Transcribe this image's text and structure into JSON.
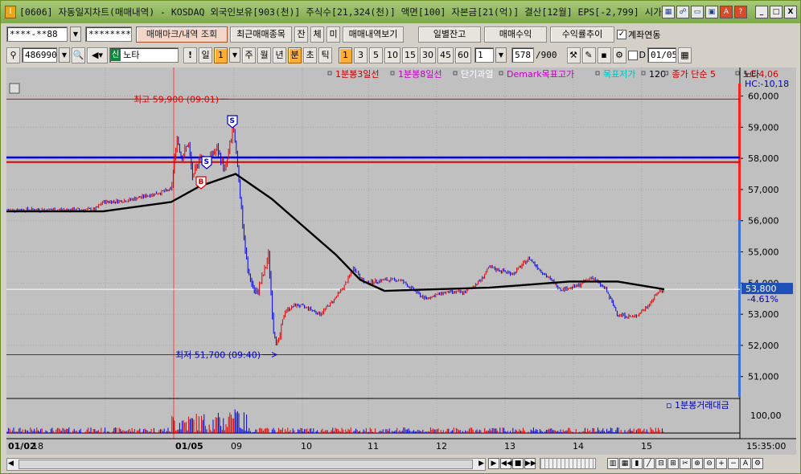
{
  "title": {
    "text": "[0606] 자동일지차트(매매내역) - KOSDAQ 외국인보유[903(천)] 주식수[21,324(천)] 액면[100] 자본금[21(억)] 결산[12월] EPS[-2,799] 시가총",
    "icon": "I",
    "icons": [
      "chart-setting-icon",
      "link-icon",
      "window-icon",
      "window-icon",
      "tile-icon",
      "red-a-icon",
      "help-icon"
    ],
    "help": "?",
    "alert": "A",
    "min": "_",
    "max": "□",
    "close": "X"
  },
  "toolbar1": {
    "account": "****-**88",
    "password": "********",
    "btn_mark": "매매마크/내역 조회",
    "btn_recent": "최근매매종목",
    "btn_jan": "잔",
    "btn_che": "체",
    "btn_mi": "미",
    "btn_history": "매매내역보기",
    "btn_daily": "일별잔고",
    "btn_profit": "매매수익",
    "btn_rate": "수익률추이",
    "chk_account": "계좌연동"
  },
  "toolbar2": {
    "code": "486990",
    "market": "신",
    "name": "노타",
    "excl": "!",
    "il": "일",
    "one": "1",
    "periods": [
      "주",
      "월",
      "년",
      "분",
      "초",
      "틱"
    ],
    "minutes": [
      "1",
      "3",
      "5",
      "10",
      "15",
      "30",
      "45",
      "60"
    ],
    "count": "1",
    "counter": "578",
    "total": "/900",
    "chk_d": "D",
    "date": "01/05"
  },
  "legend": {
    "items": [
      "1분봉3일선",
      "1분봉8일선",
      "단기과열",
      "Demark목표고가",
      "목표저가",
      "120",
      "종가 단순 5",
      "노타"
    ],
    "colors": [
      "#c00000",
      "#c000c0",
      "#ffffff",
      "#c000c0",
      "#00c0c0",
      "#000000",
      "#c00000",
      "#000000"
    ]
  },
  "axis": {
    "price_ticks": [
      "60,000",
      "59,000",
      "58,000",
      "57,000",
      "56,000",
      "55,000",
      "54,000",
      "53,000",
      "52,000",
      "51,000"
    ],
    "vol_tick": "100,00",
    "time_labels": [
      "01/02",
      "18",
      "01/05",
      "09",
      "10",
      "11",
      "12",
      "13",
      "14",
      "15"
    ],
    "time_right": "15:35:00",
    "lc": "LC:4,06",
    "hc": "HC:-10,18",
    "cur_price": "53,800",
    "cur_change": "-4.61%"
  },
  "annotations": {
    "high": "최고 59,900 (09:01)",
    "low": "최저 51,700 (09:40)",
    "sell": "S",
    "buy": "B",
    "vol_legend": "1분봉거래대금"
  },
  "colors": {
    "chart_bg": "#c0c0c0",
    "candle_up": "#e00000",
    "candle_down": "#0000e0",
    "ma": "#000000",
    "axis_bg": "#c0c0c0"
  },
  "bottom": {
    "nav": [
      "▶",
      "◀◀",
      "■",
      "▶▶"
    ],
    "tools": [
      "zoom-in-icon",
      "zoom-out-icon",
      "plus-icon",
      "minus-icon",
      "text-icon",
      "settings-icon"
    ]
  }
}
